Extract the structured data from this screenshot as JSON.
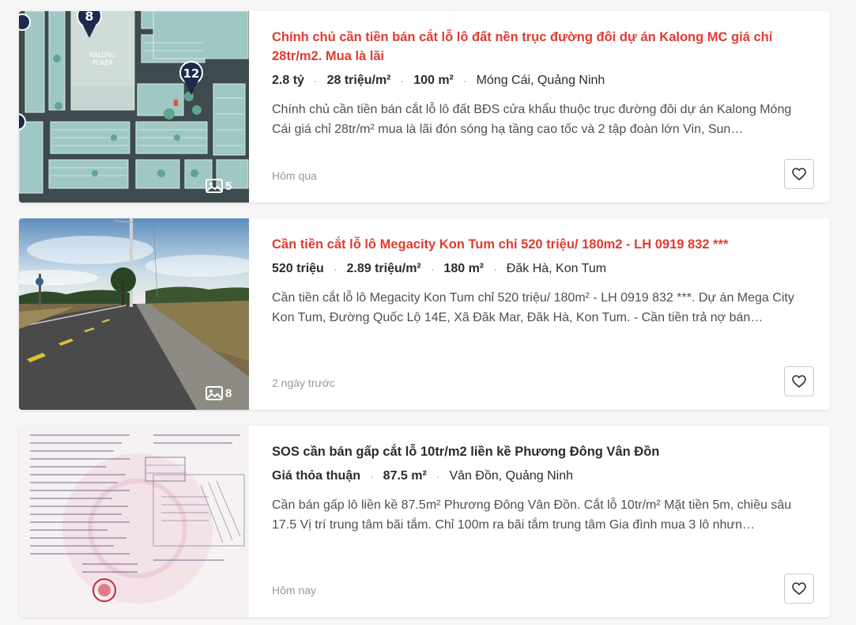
{
  "listings": [
    {
      "title": "Chính chủ cần tiền bán cắt lỗ lô đất nền trục đường đôi dự án Kalong MC giá chỉ 28tr/m2. Mua là lãi",
      "price": "2.8 tỷ",
      "price_per_m2": "28 triệu/m²",
      "area": "100 m²",
      "location": "Móng Cái, Quảng Ninh",
      "description": "Chính chủ cần tiền bán cắt lỗ lô đất BĐS cửa khẩu thuộc trục đường đôi dự án Kalong Móng Cái giá chỉ 28tr/m² mua là lãi đón sóng hạ tầng cao tốc và 2 tập đoàn lớn Vin, Sun…",
      "date": "Hôm qua",
      "photo_count": "5",
      "map_labels": {
        "marker_a": "8",
        "marker_b": "12",
        "plaza_line1": "KALONG",
        "plaza_line2": "PLAZA"
      }
    },
    {
      "title": "Cần tiền cắt lỗ lô Megacity Kon Tum chỉ 520 triệu/ 180m2 - LH 0919 832 ***",
      "price": "520 triệu",
      "price_per_m2": "2.89 triệu/m²",
      "area": "180 m²",
      "location": "Đăk Hà, Kon Tum",
      "description": "Cần tiền cắt lỗ lô Megacity Kon Tum chỉ 520 triệu/ 180m² - LH 0919 832 ***. Dự án Mega City Kon Tum, Đường Quốc Lộ 14E, Xã Đăk Mar, Đăk Hà, Kon Tum. - Cần tiền trả nợ bán…",
      "date": "2 ngày trước",
      "photo_count": "8"
    },
    {
      "title": "SOS cần bán gấp cắt lỗ 10tr/m2 liền kề Phương Đông Vân Đồn",
      "price": "Giá thỏa thuận",
      "area": "87.5 m²",
      "location": "Vân Đồn, Quảng Ninh",
      "description": "Cần bán gấp lô liền kề 87.5m² Phương Đông Vân Đồn. Cắt lỗ 10tr/m² Mặt tiền 5m, chiều sâu 17.5 Vị trí trung tâm bãi tắm. Chỉ 100m ra bãi tắm trung tâm Gia đình mua 3 lô nhưn…",
      "date": "Hôm nay"
    }
  ],
  "colors": {
    "title_accent": "#e03c31",
    "title_plain": "#2c2c2c"
  },
  "icons": {
    "photo": "image-icon",
    "favorite": "heart-icon"
  }
}
